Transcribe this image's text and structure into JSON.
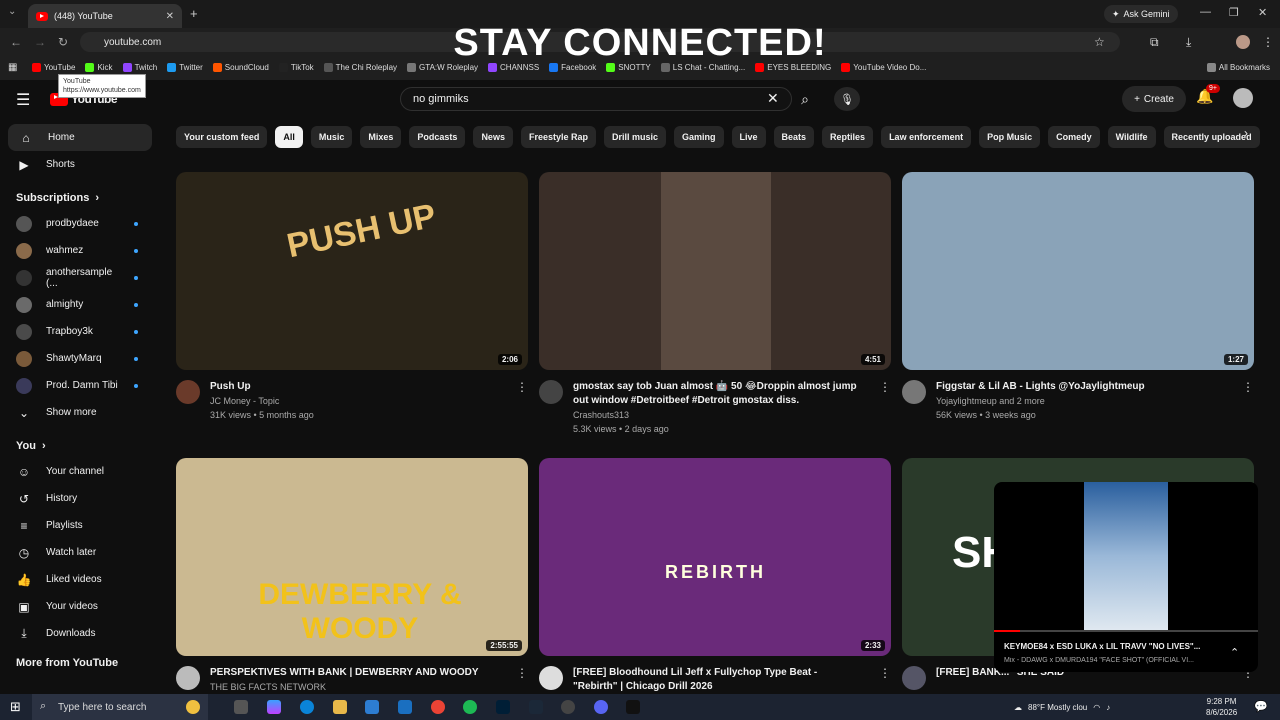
{
  "browser": {
    "tab_title": "(448) YouTube",
    "url": "youtube.com",
    "ask_gemini": "Ask Gemini",
    "overlay_banner": "STAY CONNECTED!",
    "bookmarks": [
      {
        "label": "YouTube",
        "color": "#ff0000"
      },
      {
        "label": "Kick",
        "color": "#53fc18"
      },
      {
        "label": "Twitch",
        "color": "#9146ff"
      },
      {
        "label": "Twitter",
        "color": "#1d9bf0"
      },
      {
        "label": "SoundCloud",
        "color": "#ff5500"
      },
      {
        "label": "TikTok",
        "color": "#222222"
      },
      {
        "label": "The Chi Roleplay",
        "color": "#555555"
      },
      {
        "label": "GTA:W Roleplay",
        "color": "#777777"
      },
      {
        "label": "CHANNSS",
        "color": "#9146ff"
      },
      {
        "label": "Facebook",
        "color": "#1877f2"
      },
      {
        "label": "SNOTTY",
        "color": "#53fc18"
      },
      {
        "label": "LS Chat - Chatting...",
        "color": "#666666"
      },
      {
        "label": "EYES BLEEDING",
        "color": "#ff0000"
      },
      {
        "label": "YouTube Video Do...",
        "color": "#ff0000"
      }
    ],
    "all_bookmarks": "All Bookmarks",
    "tooltip_title": "YouTube",
    "tooltip_url": "https://www.youtube.com"
  },
  "youtube": {
    "logo": "YouTube",
    "search_value": "no gimmiks",
    "create_label": "Create",
    "notif_badge": "9+",
    "sidebar": {
      "main": [
        {
          "label": "Home",
          "icon": "home-icon",
          "glyph": "⌂",
          "active": true
        },
        {
          "label": "Shorts",
          "icon": "shorts-icon",
          "glyph": "▶"
        }
      ],
      "subs_heading": "Subscriptions",
      "subs": [
        {
          "label": "prodbydaee",
          "color": "#555"
        },
        {
          "label": "wahmez",
          "color": "#8a6a4a"
        },
        {
          "label": "anothersample (...",
          "color": "#333"
        },
        {
          "label": "almighty",
          "color": "#6a6a6a"
        },
        {
          "label": "Trapboy3k",
          "color": "#4a4a4a"
        },
        {
          "label": "ShawtyMarq",
          "color": "#7a5a3a"
        },
        {
          "label": "Prod. Damn Tibi",
          "color": "#3a3a5a"
        }
      ],
      "show_more": "Show more",
      "you_heading": "You",
      "you": [
        {
          "label": "Your channel",
          "icon": "your-channel-icon",
          "glyph": "☺"
        },
        {
          "label": "History",
          "icon": "history-icon",
          "glyph": "↺"
        },
        {
          "label": "Playlists",
          "icon": "playlists-icon",
          "glyph": "≡"
        },
        {
          "label": "Watch later",
          "icon": "watch-later-icon",
          "glyph": "◷"
        },
        {
          "label": "Liked videos",
          "icon": "liked-icon",
          "glyph": "👍"
        },
        {
          "label": "Your videos",
          "icon": "your-videos-icon",
          "glyph": "▣"
        },
        {
          "label": "Downloads",
          "icon": "downloads-icon",
          "glyph": "⤓"
        }
      ],
      "more_heading": "More from YouTube"
    },
    "chips": [
      "Your custom feed",
      "All",
      "Music",
      "Mixes",
      "Podcasts",
      "News",
      "Freestyle Rap",
      "Drill music",
      "Gaming",
      "Live",
      "Beats",
      "Reptiles",
      "Law enforcement",
      "Pop Music",
      "Comedy",
      "Wildlife",
      "Recently uploaded"
    ],
    "videos": [
      {
        "title": "Push Up",
        "channel": "JC Money - Topic",
        "stats": "31K views • 5 months ago",
        "duration": "2:06",
        "thumb_text": "PUSH UP",
        "bg": "#2a2418"
      },
      {
        "title": "gmostax say tob Juan almost 🤖 50 😂Droppin almost jump out window #Detroitbeef #Detroit gmostax diss.",
        "channel": "Crashouts313",
        "stats": "5.3K views • 2 days ago",
        "duration": "4:51",
        "thumb_text": "",
        "bg": "#3a2e28"
      },
      {
        "title": "Figgstar & Lil AB - Lights @YoJaylightmeup",
        "channel": "Yojaylightmeup and 2 more",
        "stats": "56K views • 3 weeks ago",
        "duration": "1:27",
        "thumb_text": "",
        "bg": "#8aa3b8"
      },
      {
        "title": "PERSPEKTIVES WITH BANK | DEWBERRY AND WOODY",
        "channel": "THE BIG FACTS NETWORK",
        "stats": "",
        "duration": "2:55:55",
        "thumb_text": "DEWBERRY & WOODY",
        "bg": "#cbb991"
      },
      {
        "title": "[FREE] Bloodhound Lil Jeff x Fullychop Type Beat - \"Rebirth\" | Chicago Drill 2026",
        "channel": "",
        "stats": "",
        "duration": "2:33",
        "thumb_text": "REBIRTH",
        "bg": "#6a2a7a"
      },
      {
        "title": "[FREE] BANK... \"SHE SAID\"",
        "channel": "",
        "stats": "",
        "duration": "",
        "thumb_text": "SH",
        "bg": "#2a3a2a"
      }
    ],
    "miniplayer": {
      "title": "KEYMOE84 x ESD LUKA x LIL TRAVV \"NO LIVES\"...",
      "subtitle": "Mix - DDAWG x DMURDA194 \"FACE SHOT\" (OFFICIAL VI...",
      "progress": 0.1
    }
  },
  "taskbar": {
    "search_placeholder": "Type here to search",
    "weather": "88°F  Mostly clou",
    "time": "9:28 PM",
    "date": "8/6/2026"
  }
}
